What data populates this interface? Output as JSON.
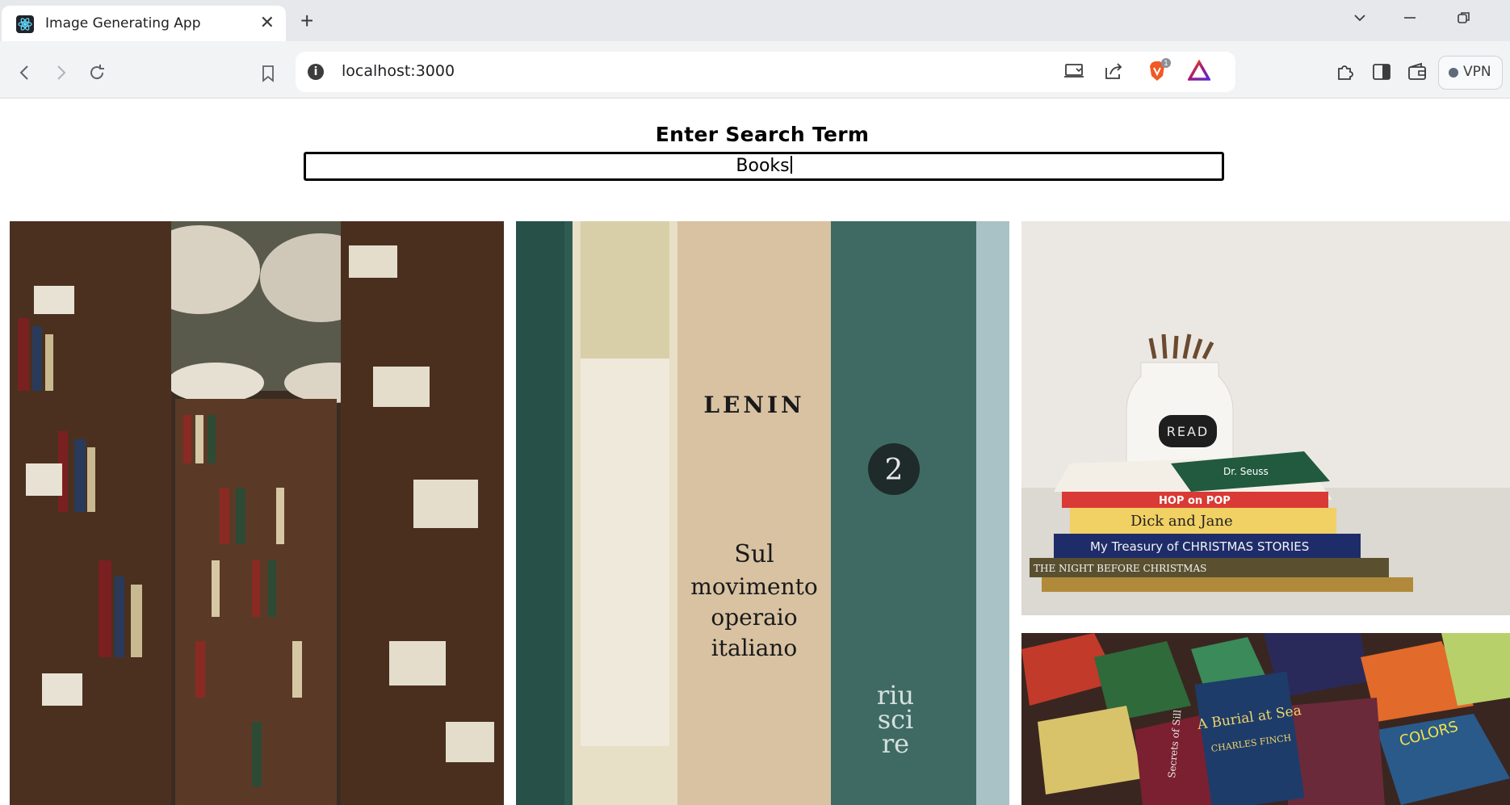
{
  "browser": {
    "tab_title": "Image Generating App",
    "tab_close": "✕",
    "new_tab": "+",
    "url": "localhost:3000",
    "site_info": "i",
    "vpn_label": "VPN",
    "shield_badge": "1"
  },
  "page": {
    "search_label": "Enter Search Term",
    "search_value": "Books"
  },
  "photos": {
    "photo_2_text_lenin": "LENIN",
    "photo_2_text_title": [
      "Sul",
      "movimento",
      "operaio",
      "italiano"
    ],
    "photo_2_number": "2",
    "photo_2_spine_text": [
      "riu",
      "sci",
      "re"
    ],
    "photo_3_jar_label": "READ",
    "photo_3_book_titles": [
      "HOP on POP",
      "Dick and Jane",
      "My Treasury of CHRISTMAS STORIES",
      "THE NIGHT BEFORE CHRISTMAS",
      "Dr. Seuss"
    ],
    "photo_4_book_titles": [
      "A Burial at Sea",
      "CHARLES FINCH",
      "COLORS",
      "Secrets of Sill"
    ]
  },
  "colors": {
    "chrome_bg": "#e6e8ec",
    "toolbar_bg": "#f1f3f4",
    "brave_orange": "#f05a24"
  }
}
